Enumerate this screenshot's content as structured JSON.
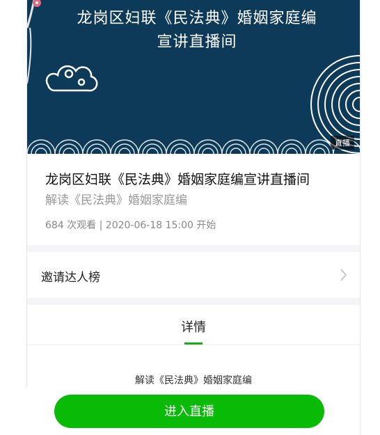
{
  "banner": {
    "title_line1": "龙岗区妇联《民法典》婚姻家庭编",
    "title_line2": "宣讲直播间",
    "badge": "直播"
  },
  "info": {
    "title": "龙岗区妇联《民法典》婚姻家庭编宣讲直播间",
    "subtitle": "解读《民法典》婚姻家庭编",
    "meta": "684 次观看 | 2020-06-18 15:00 开始"
  },
  "invite": {
    "label": "邀请达人榜"
  },
  "tabs": {
    "details_label": "详情"
  },
  "detail": {
    "text": "解读《民法典》婚姻家庭编"
  },
  "bottom": {
    "enter_label": "进入直播"
  },
  "colors": {
    "accent": "#09bb07",
    "banner_bg": "#0e3a5a"
  }
}
